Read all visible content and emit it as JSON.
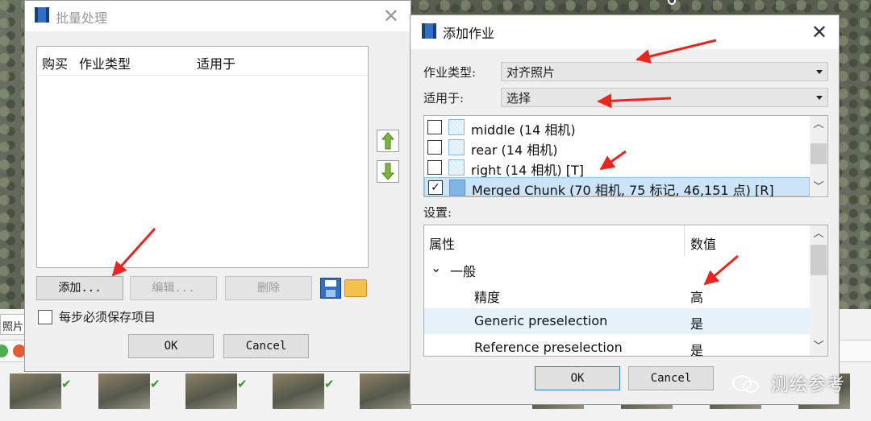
{
  "batch_dialog": {
    "title": "批量处理",
    "columns": [
      "购买",
      "作业类型",
      "适用于"
    ],
    "buttons": {
      "add": "添加...",
      "edit": "编辑...",
      "delete": "删除",
      "ok": "OK",
      "cancel": "Cancel"
    },
    "save_each_step_label": "每步必须保存项目"
  },
  "background": {
    "tab_label": "照片"
  },
  "add_job_dialog": {
    "title": "添加作业",
    "job_type_label": "作业类型:",
    "job_type_value": "对齐照片",
    "apply_to_label": "适用于:",
    "apply_to_value": "选择",
    "chunks": [
      {
        "label": "middle (14 相机)",
        "checked": false,
        "selected": false
      },
      {
        "label": "rear (14 相机)",
        "checked": false,
        "selected": false
      },
      {
        "label": "right (14 相机) [T]",
        "checked": false,
        "selected": false
      },
      {
        "label": "Merged Chunk (70 相机, 75 标记, 46,151 点) [R]",
        "checked": true,
        "selected": true
      }
    ],
    "settings_label": "设置:",
    "settings_columns": {
      "property": "属性",
      "value": "数值"
    },
    "settings_group": "一般",
    "settings": [
      {
        "name": "精度",
        "value": "高",
        "highlight": false
      },
      {
        "name": "Generic preselection",
        "value": "是",
        "highlight": true
      },
      {
        "name": "Reference preselection",
        "value": "是",
        "highlight": false
      }
    ],
    "buttons": {
      "ok": "OK",
      "cancel": "Cancel"
    }
  },
  "watermark": "测绘参考",
  "colors": {
    "annotation_arrow": "#e8261f",
    "accent": "#2b7bd4",
    "check_green": "#2e9b2e"
  }
}
